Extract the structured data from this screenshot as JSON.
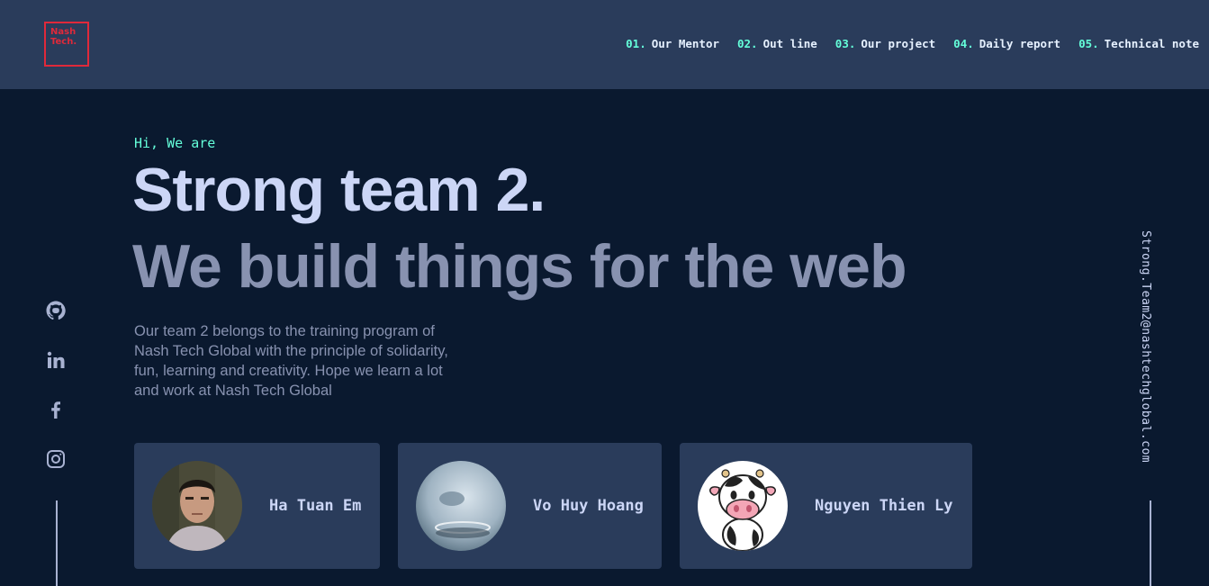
{
  "logo": {
    "line1": "Nash",
    "line2": "Tech."
  },
  "nav": [
    {
      "num": "01.",
      "label": "Our Mentor"
    },
    {
      "num": "02.",
      "label": "Out line"
    },
    {
      "num": "03.",
      "label": "Our project"
    },
    {
      "num": "04.",
      "label": "Daily report"
    },
    {
      "num": "05.",
      "label": "Technical note"
    }
  ],
  "hero": {
    "intro": "Hi, We are",
    "title": "Strong team 2.",
    "subtitle": "We build things for the web",
    "description": "Our team 2 belongs to the training program of Nash Tech Global with the principle of solidarity, fun, learning and creativity. Hope we learn a lot and work at Nash Tech Global"
  },
  "social": [
    "github-icon",
    "linkedin-icon",
    "facebook-icon",
    "instagram-icon"
  ],
  "email": "Strong.Team2@nashtechglobal.com",
  "members": [
    {
      "name": "Ha Tuan Em"
    },
    {
      "name": "Vo Huy Hoang"
    },
    {
      "name": "Nguyen Thien Ly"
    }
  ],
  "colors": {
    "background": "#0a192f",
    "header": "#2a3c5b",
    "accent": "#64ffda",
    "logo": "#e0293a",
    "title": "#ccd6f6",
    "subtitle": "#8892b0"
  }
}
